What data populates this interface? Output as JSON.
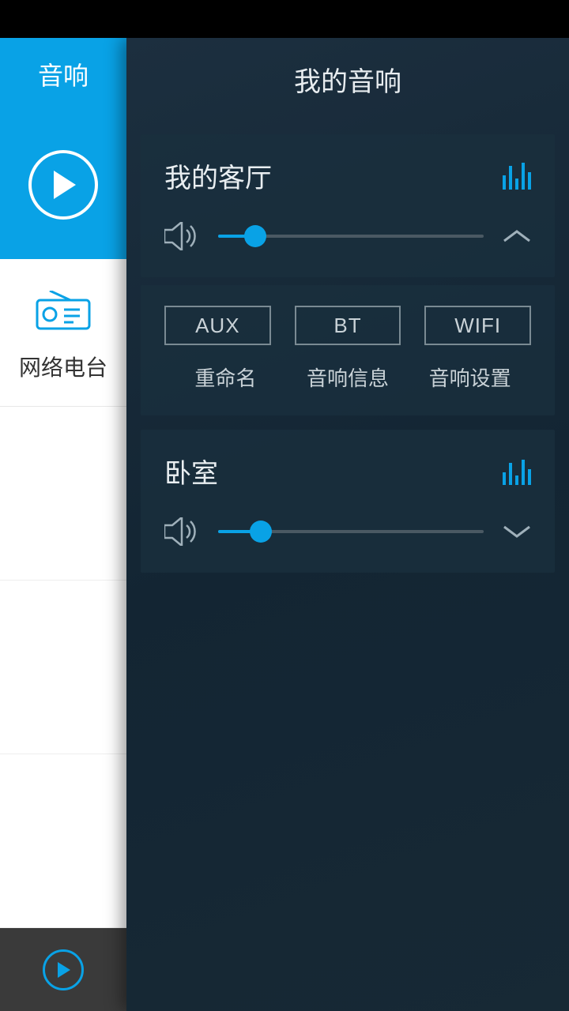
{
  "sidebar": {
    "header": "音响",
    "radio_label": "网络电台"
  },
  "drawer": {
    "title": "我的音响",
    "rooms": [
      {
        "name": "我的客厅",
        "volume_pct": 14,
        "expanded": true,
        "sources": [
          "AUX",
          "BT",
          "WIFI"
        ],
        "actions": [
          "重命名",
          "音响信息",
          "音响设置"
        ]
      },
      {
        "name": "卧室",
        "volume_pct": 16,
        "expanded": false
      }
    ]
  }
}
